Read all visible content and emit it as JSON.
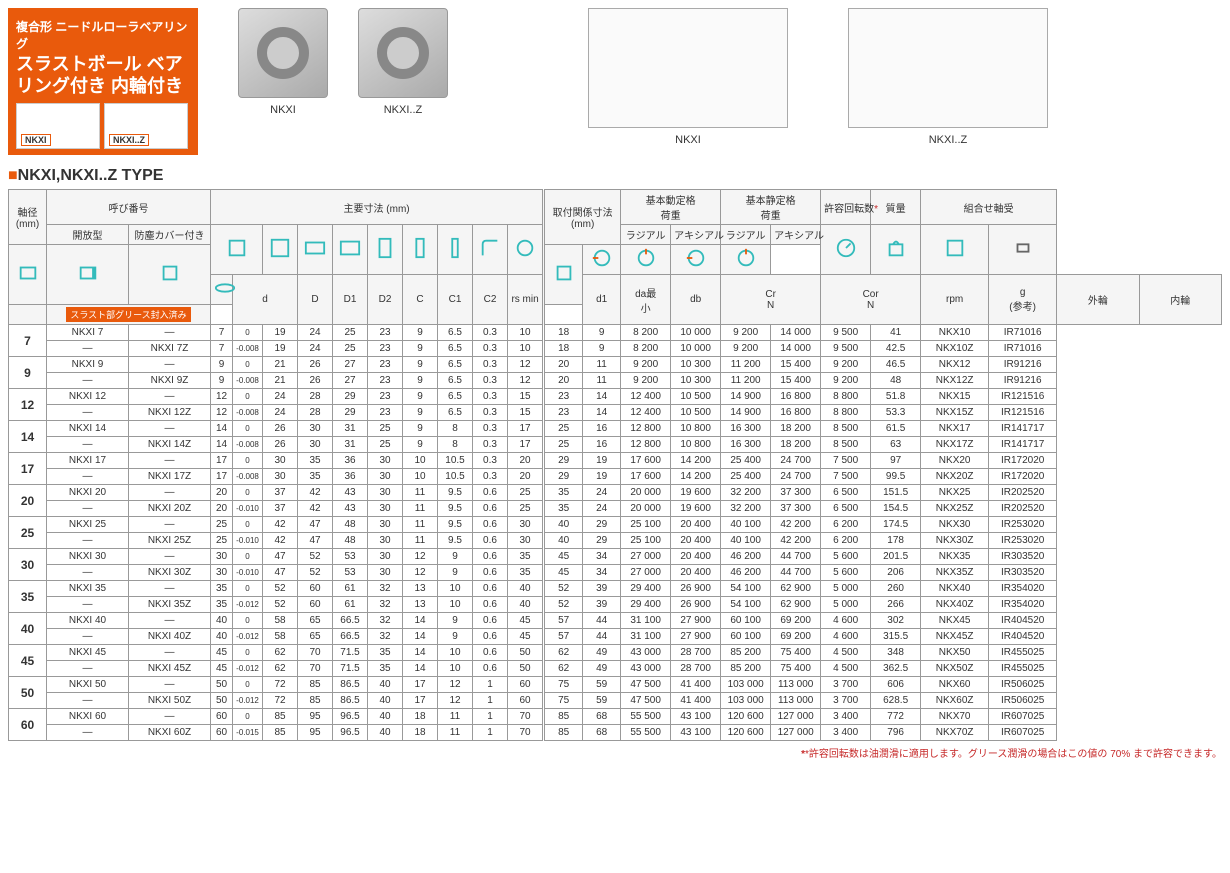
{
  "header_box": {
    "line1": "複合形\nニードルローラベアリング",
    "line2": "スラストボール\nベアリング付き\n内輪付き",
    "mini_caps": [
      "NKXI",
      "NKXI..Z"
    ]
  },
  "product_labels": [
    "NKXI",
    "NKXI..Z"
  ],
  "tech_labels": [
    "NKXI",
    "NKXI..Z"
  ],
  "type_heading": "NKXI,NKXI..Z  TYPE",
  "col_headers": {
    "shaft": "軸径\n(mm)",
    "designation": "呼び番号",
    "open": "開放型",
    "shield": "防塵カバー付き",
    "grease_note": "スラスト部グリース封入済み",
    "main_dim": "主要寸法 (mm)",
    "mount_dim": "取付関係寸法\n(mm)",
    "dyn": "基本動定格\n荷重",
    "stat": "基本静定格\n荷重",
    "speed": "許容回転数",
    "mass": "質量",
    "combo": "組合せ軸受",
    "radial": "ラジアル",
    "axial": "アキシアル",
    "d": "d",
    "D": "D",
    "D1": "D1",
    "D2": "D2",
    "C": "C",
    "C1": "C1",
    "C2": "C2",
    "rsmin": "rs min",
    "d1": "d1",
    "da": "da最\n小",
    "db": "db",
    "Cr": "Cr\nN",
    "Cor": "Cor\nN",
    "rpm": "rpm",
    "g": "g\n(参考)",
    "outer": "外輪",
    "inner": "内輪",
    "star": "*"
  },
  "tolerance_labels": {
    "zero": "0"
  },
  "chart_data": {
    "type": "table",
    "rows": [
      {
        "shaft": "7",
        "open": "NKXI 7",
        "shield": "NKXI 7Z",
        "d_nom": "7",
        "d_tol": "-0.008",
        "D": "19",
        "D1": "24",
        "D2": "25",
        "C": "23",
        "C1": "9",
        "C2": "6.5",
        "rsmin": "0.3",
        "d1": "10",
        "da": "18",
        "db": "9",
        "Cr_r": "8 200",
        "Cr_a": "10 000",
        "Cor_r": "9 200",
        "Cor_a": "14 000",
        "rpm": "9 500",
        "mass_o": "41",
        "mass_s": "42.5",
        "outer_o": "NKX10",
        "outer_s": "NKX10Z",
        "inner": "IR71016"
      },
      {
        "shaft": "9",
        "open": "NKXI 9",
        "shield": "NKXI 9Z",
        "d_nom": "9",
        "d_tol": "-0.008",
        "D": "21",
        "D1": "26",
        "D2": "27",
        "C": "23",
        "C1": "9",
        "C2": "6.5",
        "rsmin": "0.3",
        "d1": "12",
        "da": "20",
        "db": "11",
        "Cr_r": "9 200",
        "Cr_a": "10 300",
        "Cor_r": "11 200",
        "Cor_a": "15 400",
        "rpm": "9 200",
        "mass_o": "46.5",
        "mass_s": "48",
        "outer_o": "NKX12",
        "outer_s": "NKX12Z",
        "inner": "IR91216"
      },
      {
        "shaft": "12",
        "open": "NKXI 12",
        "shield": "NKXI 12Z",
        "d_nom": "12",
        "d_tol": "-0.008",
        "D": "24",
        "D1": "28",
        "D2": "29",
        "C": "23",
        "C1": "9",
        "C2": "6.5",
        "rsmin": "0.3",
        "d1": "15",
        "da": "23",
        "db": "14",
        "Cr_r": "12 400",
        "Cr_a": "10 500",
        "Cor_r": "14 900",
        "Cor_a": "16 800",
        "rpm": "8 800",
        "mass_o": "51.8",
        "mass_s": "53.3",
        "outer_o": "NKX15",
        "outer_s": "NKX15Z",
        "inner": "IR121516"
      },
      {
        "shaft": "14",
        "open": "NKXI 14",
        "shield": "NKXI 14Z",
        "d_nom": "14",
        "d_tol": "-0.008",
        "D": "26",
        "D1": "30",
        "D2": "31",
        "C": "25",
        "C1": "9",
        "C2": "8",
        "rsmin": "0.3",
        "d1": "17",
        "da": "25",
        "db": "16",
        "Cr_r": "12 800",
        "Cr_a": "10 800",
        "Cor_r": "16 300",
        "Cor_a": "18 200",
        "rpm": "8 500",
        "mass_o": "61.5",
        "mass_s": "63",
        "outer_o": "NKX17",
        "outer_s": "NKX17Z",
        "inner": "IR141717"
      },
      {
        "shaft": "17",
        "open": "NKXI 17",
        "shield": "NKXI 17Z",
        "d_nom": "17",
        "d_tol": "-0.008",
        "D": "30",
        "D1": "35",
        "D2": "36",
        "C": "30",
        "C1": "10",
        "C2": "10.5",
        "rsmin": "0.3",
        "d1": "20",
        "da": "29",
        "db": "19",
        "Cr_r": "17 600",
        "Cr_a": "14 200",
        "Cor_r": "25 400",
        "Cor_a": "24 700",
        "rpm": "7 500",
        "mass_o": "97",
        "mass_s": "99.5",
        "outer_o": "NKX20",
        "outer_s": "NKX20Z",
        "inner": "IR172020"
      },
      {
        "shaft": "20",
        "open": "NKXI 20",
        "shield": "NKXI 20Z",
        "d_nom": "20",
        "d_tol": "-0.010",
        "D": "37",
        "D1": "42",
        "D2": "43",
        "C": "30",
        "C1": "11",
        "C2": "9.5",
        "rsmin": "0.6",
        "d1": "25",
        "da": "35",
        "db": "24",
        "Cr_r": "20 000",
        "Cr_a": "19 600",
        "Cor_r": "32 200",
        "Cor_a": "37 300",
        "rpm": "6 500",
        "mass_o": "151.5",
        "mass_s": "154.5",
        "outer_o": "NKX25",
        "outer_s": "NKX25Z",
        "inner": "IR202520"
      },
      {
        "shaft": "25",
        "open": "NKXI 25",
        "shield": "NKXI 25Z",
        "d_nom": "25",
        "d_tol": "-0.010",
        "D": "42",
        "D1": "47",
        "D2": "48",
        "C": "30",
        "C1": "11",
        "C2": "9.5",
        "rsmin": "0.6",
        "d1": "30",
        "da": "40",
        "db": "29",
        "Cr_r": "25 100",
        "Cr_a": "20 400",
        "Cor_r": "40 100",
        "Cor_a": "42 200",
        "rpm": "6 200",
        "mass_o": "174.5",
        "mass_s": "178",
        "outer_o": "NKX30",
        "outer_s": "NKX30Z",
        "inner": "IR253020"
      },
      {
        "shaft": "30",
        "open": "NKXI 30",
        "shield": "NKXI 30Z",
        "d_nom": "30",
        "d_tol": "-0.010",
        "D": "47",
        "D1": "52",
        "D2": "53",
        "C": "30",
        "C1": "12",
        "C2": "9",
        "rsmin": "0.6",
        "d1": "35",
        "da": "45",
        "db": "34",
        "Cr_r": "27 000",
        "Cr_a": "20 400",
        "Cor_r": "46 200",
        "Cor_a": "44 700",
        "rpm": "5 600",
        "mass_o": "201.5",
        "mass_s": "206",
        "outer_o": "NKX35",
        "outer_s": "NKX35Z",
        "inner": "IR303520"
      },
      {
        "shaft": "35",
        "open": "NKXI 35",
        "shield": "NKXI 35Z",
        "d_nom": "35",
        "d_tol": "-0.012",
        "D": "52",
        "D1": "60",
        "D2": "61",
        "C": "32",
        "C1": "13",
        "C2": "10",
        "rsmin": "0.6",
        "d1": "40",
        "da": "52",
        "db": "39",
        "Cr_r": "29 400",
        "Cr_a": "26 900",
        "Cor_r": "54 100",
        "Cor_a": "62 900",
        "rpm": "5 000",
        "mass_o": "260",
        "mass_s": "266",
        "outer_o": "NKX40",
        "outer_s": "NKX40Z",
        "inner": "IR354020"
      },
      {
        "shaft": "40",
        "open": "NKXI 40",
        "shield": "NKXI 40Z",
        "d_nom": "40",
        "d_tol": "-0.012",
        "D": "58",
        "D1": "65",
        "D2": "66.5",
        "C": "32",
        "C1": "14",
        "C2": "9",
        "rsmin": "0.6",
        "d1": "45",
        "da": "57",
        "db": "44",
        "Cr_r": "31 100",
        "Cr_a": "27 900",
        "Cor_r": "60 100",
        "Cor_a": "69 200",
        "rpm": "4 600",
        "mass_o": "302",
        "mass_s": "315.5",
        "outer_o": "NKX45",
        "outer_s": "NKX45Z",
        "inner": "IR404520"
      },
      {
        "shaft": "45",
        "open": "NKXI 45",
        "shield": "NKXI 45Z",
        "d_nom": "45",
        "d_tol": "-0.012",
        "D": "62",
        "D1": "70",
        "D2": "71.5",
        "C": "35",
        "C1": "14",
        "C2": "10",
        "rsmin": "0.6",
        "d1": "50",
        "da": "62",
        "db": "49",
        "Cr_r": "43 000",
        "Cr_a": "28 700",
        "Cor_r": "85 200",
        "Cor_a": "75 400",
        "rpm": "4 500",
        "mass_o": "348",
        "mass_s": "362.5",
        "outer_o": "NKX50",
        "outer_s": "NKX50Z",
        "inner": "IR455025"
      },
      {
        "shaft": "50",
        "open": "NKXI 50",
        "shield": "NKXI 50Z",
        "d_nom": "50",
        "d_tol": "-0.012",
        "D": "72",
        "D1": "85",
        "D2": "86.5",
        "C": "40",
        "C1": "17",
        "C2": "12",
        "rsmin": "1",
        "d1": "60",
        "da": "75",
        "db": "59",
        "Cr_r": "47 500",
        "Cr_a": "41 400",
        "Cor_r": "103 000",
        "Cor_a": "113 000",
        "rpm": "3 700",
        "mass_o": "606",
        "mass_s": "628.5",
        "outer_o": "NKX60",
        "outer_s": "NKX60Z",
        "inner": "IR506025"
      },
      {
        "shaft": "60",
        "open": "NKXI 60",
        "shield": "NKXI 60Z",
        "d_nom": "60",
        "d_tol": "-0.015",
        "D": "85",
        "D1": "95",
        "D2": "96.5",
        "C": "40",
        "C1": "18",
        "C2": "11",
        "rsmin": "1",
        "d1": "70",
        "da": "85",
        "db": "68",
        "Cr_r": "55 500",
        "Cr_a": "43 100",
        "Cor_r": "120 600",
        "Cor_a": "127 000",
        "rpm": "3 400",
        "mass_o": "772",
        "mass_s": "796",
        "outer_o": "NKX70",
        "outer_s": "NKX70Z",
        "inner": "IR607025"
      }
    ]
  },
  "footnote": "*許容回転数は油潤滑に適用します。グリース潤滑の場合はこの値の 70% まで許容できます。"
}
